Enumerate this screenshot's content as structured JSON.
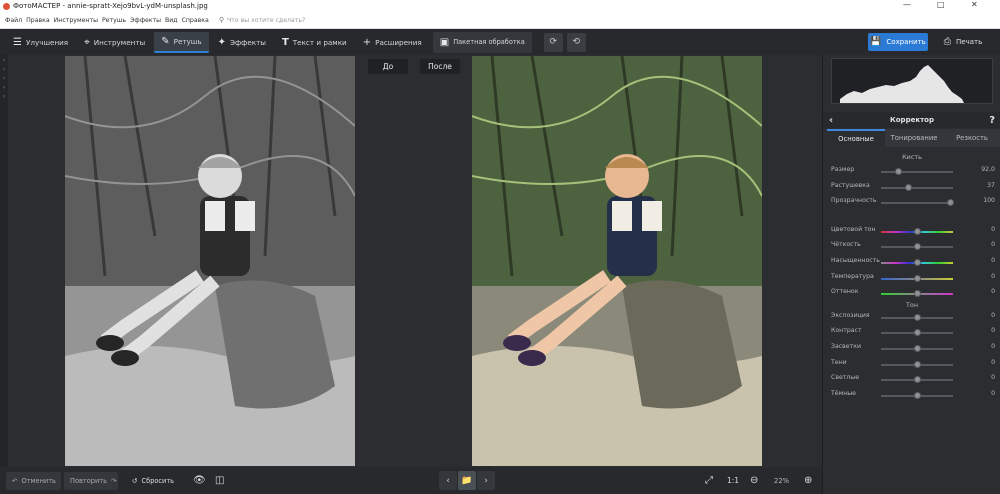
{
  "window": {
    "title": "ФотоМАСТЕР - annie-spratt-Xejo9bvL-ydM-unsplash.jpg"
  },
  "menu": {
    "items": [
      "Файл",
      "Правка",
      "Инструменты",
      "Ретушь",
      "Эффекты",
      "Вид",
      "Справка"
    ],
    "search_placeholder": "Что вы хотите сделать?"
  },
  "toolbar": {
    "tabs": [
      {
        "label": "Улучшения",
        "icon": "sliders-icon"
      },
      {
        "label": "Инструменты",
        "icon": "crop-icon"
      },
      {
        "label": "Ретушь",
        "icon": "brush-icon"
      },
      {
        "label": "Эффекты",
        "icon": "sparkle-icon"
      },
      {
        "label": "Текст и рамки",
        "icon": "text-icon"
      },
      {
        "label": "Расширения",
        "icon": "plus-icon"
      }
    ],
    "active_tab": "Ретушь",
    "batch_label": "Пакетная обработка",
    "save_label": "Сохранить",
    "print_label": "Печать"
  },
  "compare": {
    "before_label": "До",
    "after_label": "После"
  },
  "bottom": {
    "undo_label": "Отменить",
    "redo_label": "Повторить",
    "reset_label": "Сбросить",
    "zoom_fit_label": "1:1",
    "zoom_value": "22%"
  },
  "panel": {
    "title": "Корректор",
    "tabs": [
      "Основные",
      "Тонирование",
      "Резкость"
    ],
    "active_tab": "Основные",
    "brush_section": "Кисть",
    "brush": [
      {
        "label": "Размер",
        "value": "92,0",
        "pos": 0.25
      },
      {
        "label": "Растушевка",
        "value": "37",
        "pos": 0.37
      },
      {
        "label": "Прозрачность",
        "value": "100",
        "pos": 1.0
      }
    ],
    "color": [
      {
        "label": "Цветовой тон",
        "value": "0"
      },
      {
        "label": "Чёткость",
        "value": "0"
      },
      {
        "label": "Насыщенность",
        "value": "0"
      },
      {
        "label": "Температура",
        "value": "0"
      },
      {
        "label": "Оттенок",
        "value": "0"
      }
    ],
    "tone_section": "Тон",
    "tone": [
      {
        "label": "Экспозиция",
        "value": "0"
      },
      {
        "label": "Контраст",
        "value": "0"
      },
      {
        "label": "Засветки",
        "value": "0"
      },
      {
        "label": "Тени",
        "value": "0"
      },
      {
        "label": "Светлые",
        "value": "0"
      },
      {
        "label": "Тёмные",
        "value": "0"
      }
    ]
  }
}
